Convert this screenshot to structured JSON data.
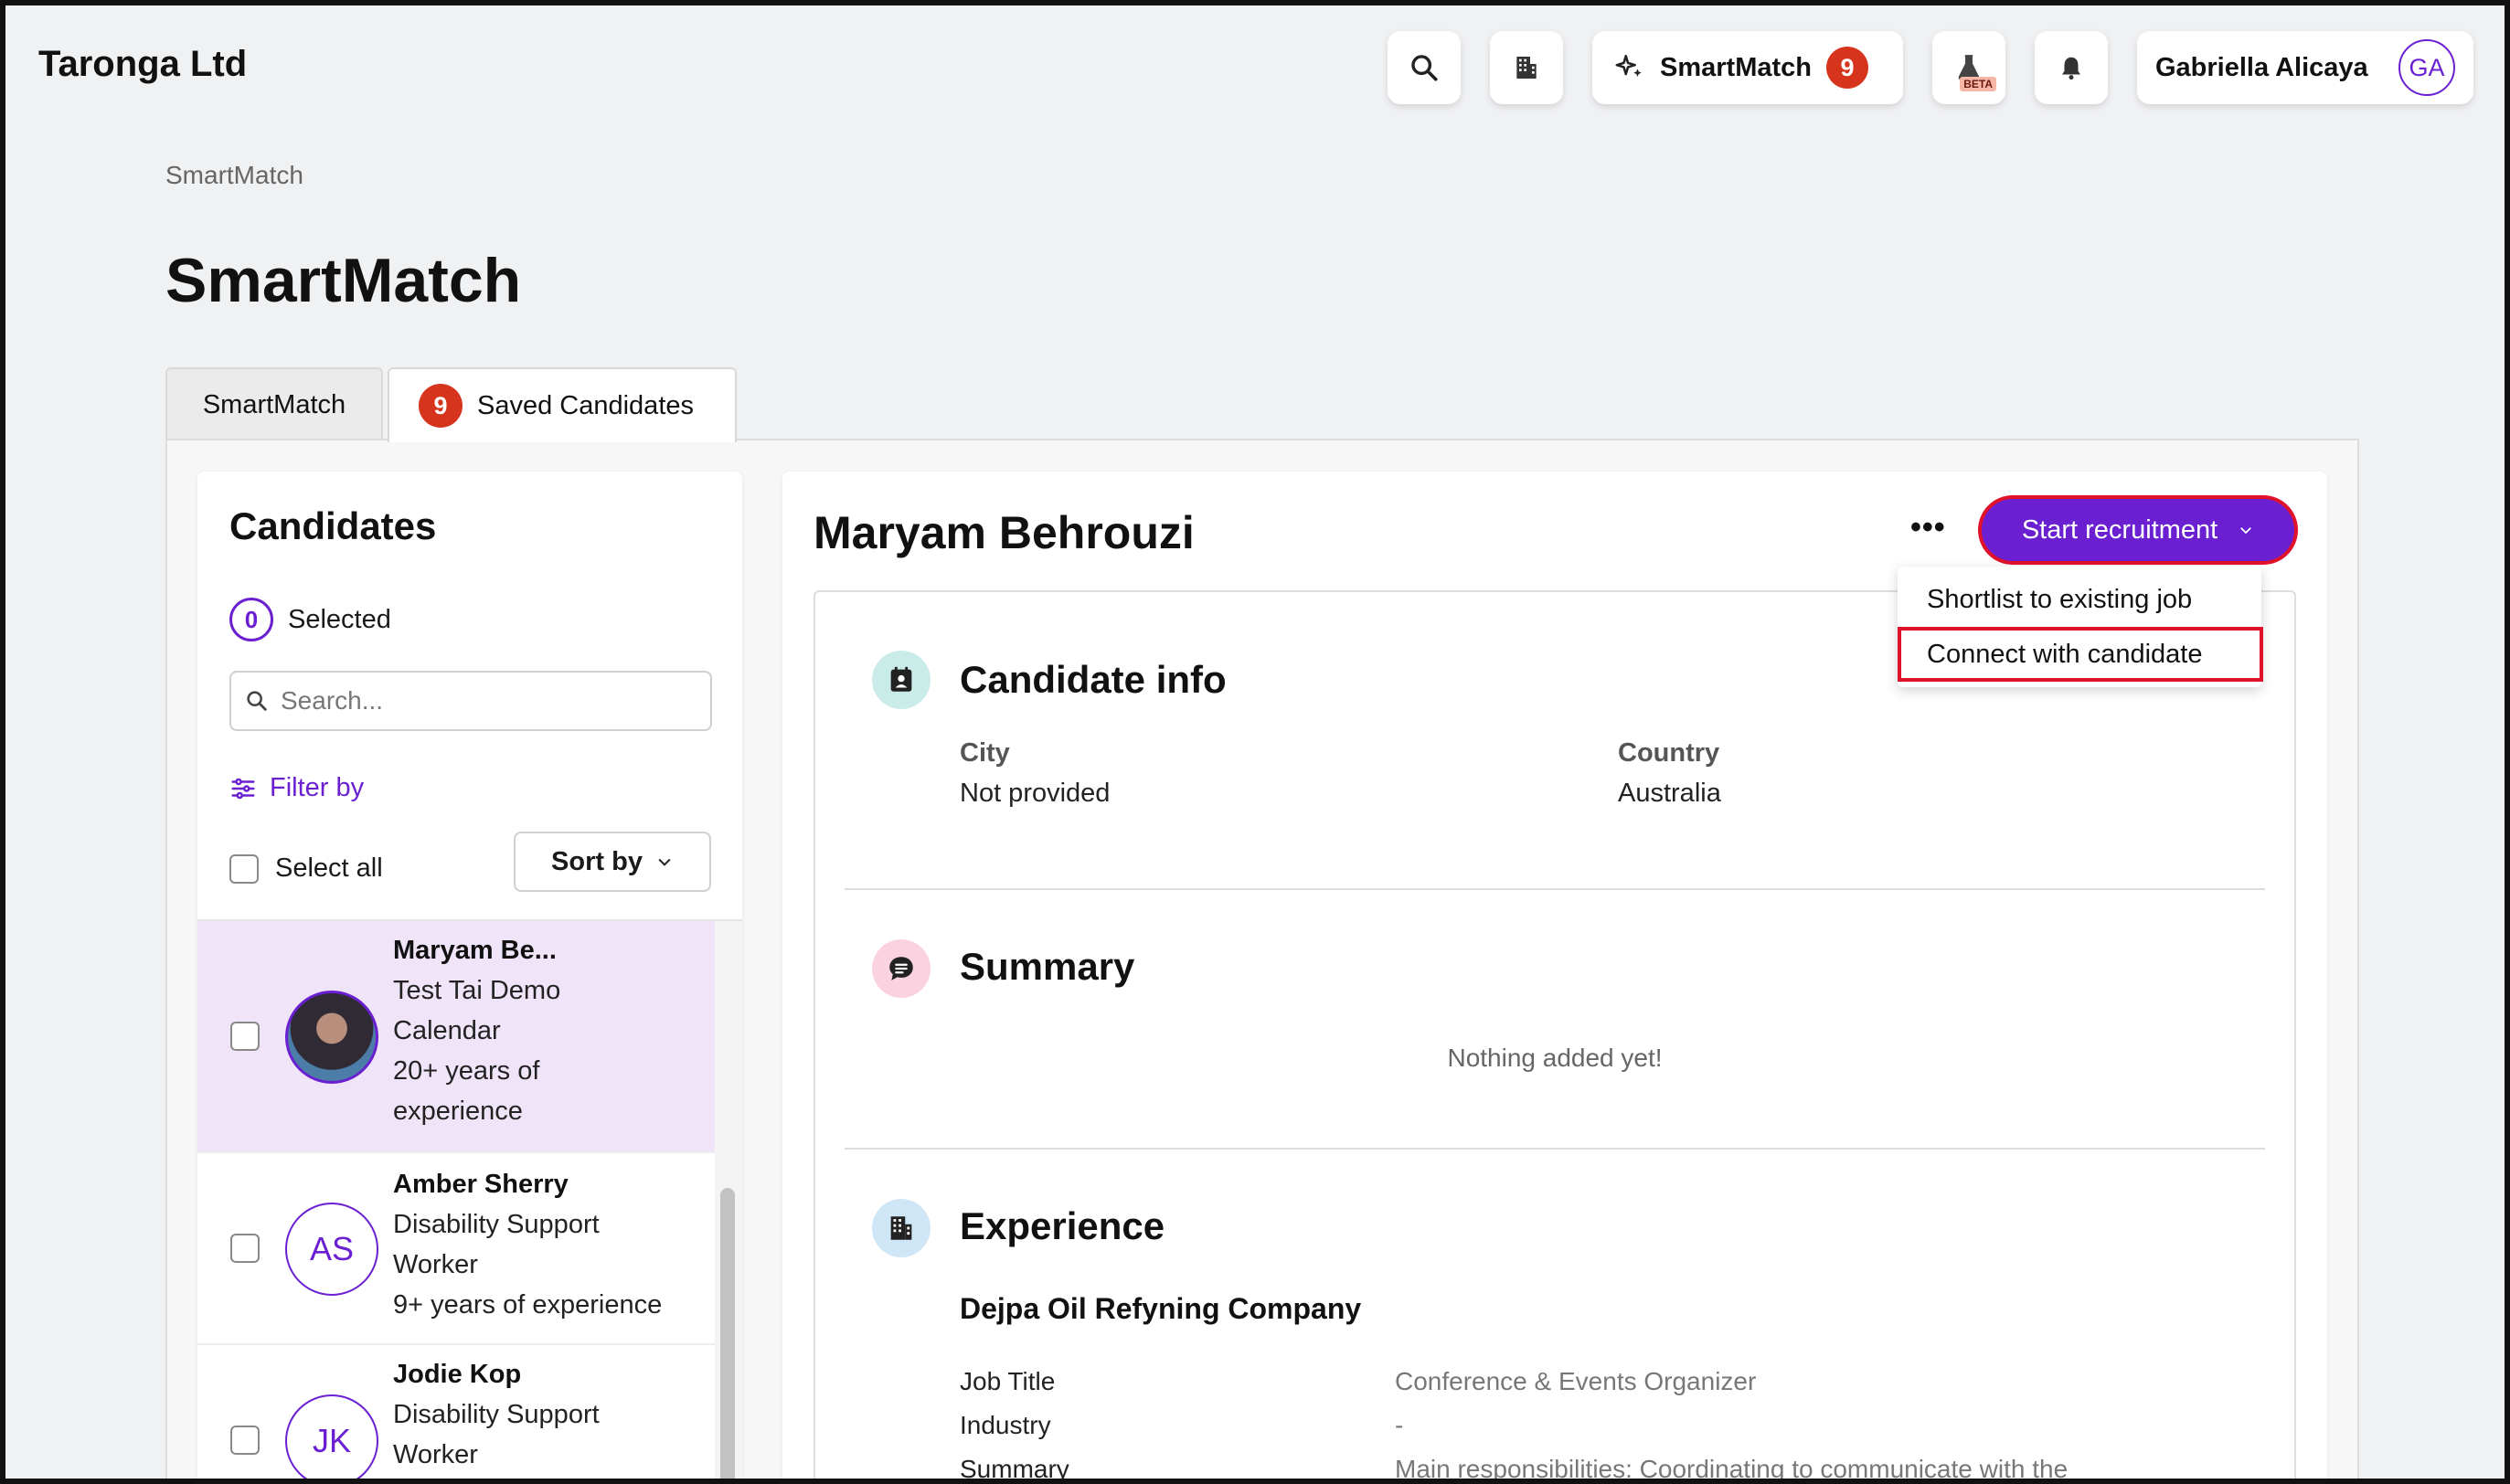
{
  "header": {
    "brand": "Taronga Ltd",
    "smartmatch_label": "SmartMatch",
    "smartmatch_count": "9",
    "beta_label": "BETA",
    "user_name": "Gabriella Alicaya",
    "user_initials": "GA"
  },
  "breadcrumb": "SmartMatch",
  "page_title": "SmartMatch",
  "tabs": [
    {
      "label": "SmartMatch"
    },
    {
      "label": "Saved Candidates",
      "count": "9"
    }
  ],
  "candidates_panel": {
    "title": "Candidates",
    "selected_count": "0",
    "selected_label": "Selected",
    "search_placeholder": "Search...",
    "filter_label": "Filter by",
    "select_all_label": "Select all",
    "sort_label": "Sort by",
    "items": [
      {
        "name": "Maryam Be...",
        "lines": [
          "Test Tai Demo",
          "Calendar",
          "20+ years of",
          "experience"
        ],
        "initials": ""
      },
      {
        "name": "Amber Sherry",
        "lines": [
          "Disability Support",
          "Worker",
          "9+ years of experience"
        ],
        "initials": "AS"
      },
      {
        "name": "Jodie Kop",
        "lines": [
          "Disability Support",
          "Worker"
        ],
        "initials": "JK"
      }
    ]
  },
  "detail": {
    "name": "Maryam Behrouzi",
    "more_label": "•••",
    "start_recruitment_label": "Start recruitment",
    "dropdown": [
      "Shortlist to existing job",
      "Connect with candidate"
    ],
    "candidate_info": {
      "title": "Candidate info",
      "city_label": "City",
      "city_value": "Not provided",
      "country_label": "Country",
      "country_value": "Australia"
    },
    "summary": {
      "title": "Summary",
      "empty": "Nothing added yet!"
    },
    "experience": {
      "title": "Experience",
      "company": "Dejpa Oil Refyning Company",
      "rows": [
        {
          "label": "Job Title",
          "value": "Conference & Events Organizer"
        },
        {
          "label": "Industry",
          "value": "-"
        },
        {
          "label": "Summary",
          "value": "Main responsibilities:   Coordinating to communicate with the"
        }
      ]
    }
  },
  "colors": {
    "accent": "#6a1fd1",
    "badge": "#d6341c",
    "highlight_outline": "#e0112b",
    "active_row": "#efe4f8"
  }
}
